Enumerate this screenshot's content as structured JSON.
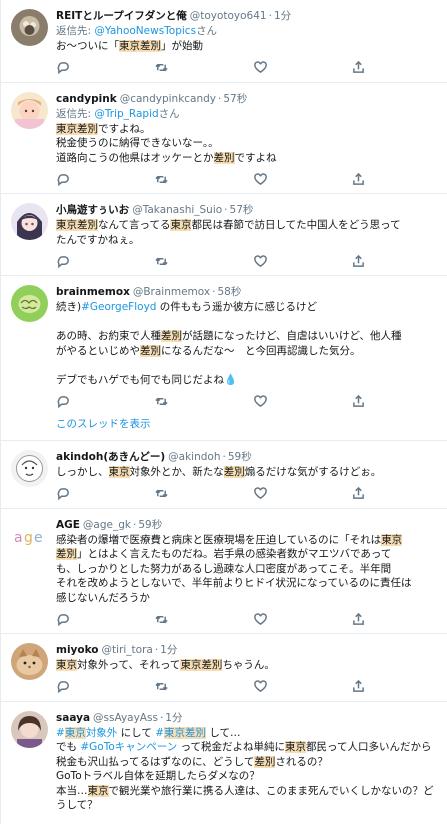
{
  "colors": {
    "link": "#1b95e0",
    "highlight": "#f7ddb3",
    "muted": "#657786"
  },
  "thread_link_label": "このスレッドを表示",
  "tweets": [
    {
      "name": "REITとループイフダンと俺",
      "handle": "@toyotoyo641",
      "time": "1分",
      "reply_prefix": "返信先: ",
      "reply_handle": "@YahooNewsTopics",
      "reply_suffix": "さん",
      "segments": [
        [
          "t",
          "お〜ついに「"
        ],
        [
          "h",
          "東京差別"
        ],
        [
          "t",
          "」が始動"
        ]
      ]
    },
    {
      "name": "candypink",
      "handle": "@candypinkcandy",
      "time": "57秒",
      "reply_prefix": "返信先: ",
      "reply_handle": "@Trip_Rapid",
      "reply_suffix": "さん",
      "segments": [
        [
          "h",
          "東京差別"
        ],
        [
          "t",
          "ですよね。\n税金使うのに納得できないなー。。\n道路向こうの他県はオッケーとか"
        ],
        [
          "h",
          "差別"
        ],
        [
          "t",
          "ですよね"
        ]
      ]
    },
    {
      "name": "小鳥遊すぅいお",
      "handle": "@Takanashi_Suio",
      "time": "57秒",
      "segments": [
        [
          "h",
          "東京差別"
        ],
        [
          "t",
          "なんて言ってる"
        ],
        [
          "h",
          "東京"
        ],
        [
          "t",
          "都民は春節で訪日してた中国人をどう思って\nたんですかねぇ。"
        ]
      ]
    },
    {
      "name": "brainmemox",
      "handle": "@Brainmemox",
      "time": "58秒",
      "thread": true,
      "segments": [
        [
          "t",
          "続き)"
        ],
        [
          "l",
          "#GeorgeFloyd"
        ],
        [
          "t",
          " の件ももう遥か彼方に感じるけど\n\nあの時、お約束で人種"
        ],
        [
          "h",
          "差別"
        ],
        [
          "t",
          "が話題になったけど、自虐はいいけど、他人種\nがやるといじめや"
        ],
        [
          "h",
          "差別"
        ],
        [
          "t",
          "になるんだな〜　と今回再認識した気分。\n\nデブでもハゲでも何でも同じだよね💧"
        ]
      ]
    },
    {
      "name": "akindoh(あきんどー)",
      "handle": "@akindoh",
      "time": "59秒",
      "segments": [
        [
          "t",
          "しっかし、"
        ],
        [
          "h",
          "東京"
        ],
        [
          "t",
          "対象外とか、新たな"
        ],
        [
          "h",
          "差別"
        ],
        [
          "t",
          "煽るだけな気がするけどぉ。"
        ]
      ]
    },
    {
      "name": "AGE",
      "handle": "@age_gk",
      "time": "59秒",
      "segments": [
        [
          "t",
          "感染者の爆増で医療費と病床と医療現場を圧迫しているのに「それは"
        ],
        [
          "h",
          "東京\n差別"
        ],
        [
          "t",
          "」とはよく言えたものだね。岩手県の感染者数がマエツバであって\nも、しっかりとした努力があるし過疎な人口密度があってこそ。半年間\nそれを改めようとしないで、半年前よりヒドイ状況になっているのに責任は\n感じないんだろうか"
        ]
      ]
    },
    {
      "name": "miyoko",
      "handle": "@tiri_tora",
      "time": "1分",
      "segments": [
        [
          "h",
          "東京"
        ],
        [
          "t",
          "対象外って、それって"
        ],
        [
          "h",
          "東京差別"
        ],
        [
          "t",
          "ちゃうん。"
        ]
      ]
    },
    {
      "name": "saaya",
      "handle": "@ssAyayAss",
      "time": "1分",
      "last": true,
      "segments": [
        [
          "l",
          "#"
        ],
        [
          "hl",
          "東京"
        ],
        [
          "l",
          "対象外"
        ],
        [
          "t",
          " にして "
        ],
        [
          "l",
          "#"
        ],
        [
          "hl",
          "東京差別"
        ],
        [
          "t",
          " して…\nでも "
        ],
        [
          "l",
          "#GoToキャンペーン"
        ],
        [
          "t",
          " って税金だよね単純に"
        ],
        [
          "h",
          "東京"
        ],
        [
          "t",
          "都民って人口多いんだから\n税金も沢山払ってるはずなのに、どうして"
        ],
        [
          "h",
          "差別"
        ],
        [
          "t",
          "されるの？\nGoToトラベル自体を延期したらダメなの？\n本当…"
        ],
        [
          "h",
          "東京"
        ],
        [
          "t",
          "で観光業や旅行業に携る人達は、このまま死んでいくしかないの？どうして？"
        ]
      ]
    }
  ]
}
